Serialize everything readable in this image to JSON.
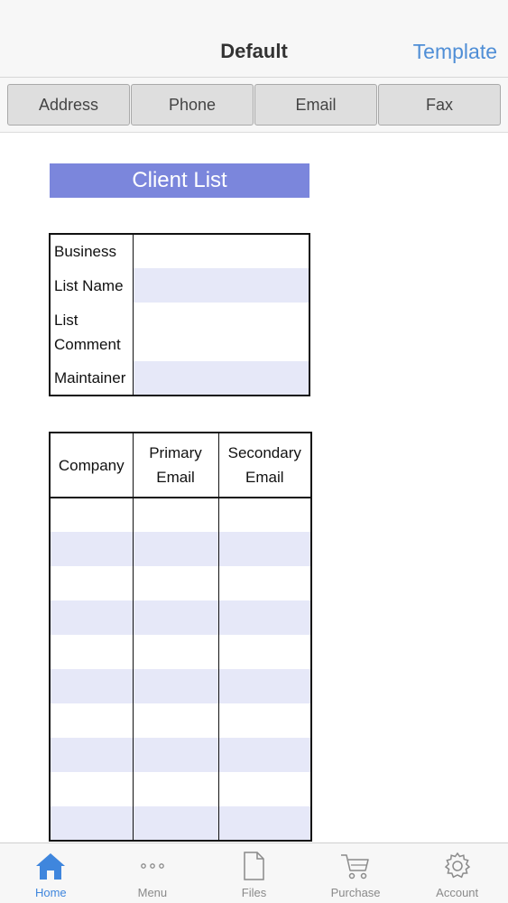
{
  "nav": {
    "title": "Default",
    "right_label": "Template"
  },
  "segments": [
    "Address",
    "Phone",
    "Email",
    "Fax"
  ],
  "document": {
    "title": "Client List",
    "info_rows": [
      {
        "label": "Business",
        "value": ""
      },
      {
        "label": "List Name",
        "value": ""
      },
      {
        "label": "List\nComment",
        "value": ""
      },
      {
        "label": "Maintainer",
        "value": ""
      }
    ],
    "columns": [
      "Company",
      "Primary\nEmail",
      "Secondary\nEmail"
    ],
    "row_count": 10
  },
  "tabbar": {
    "items": [
      {
        "label": "Home",
        "icon": "home-icon",
        "active": true
      },
      {
        "label": "Menu",
        "icon": "more-icon",
        "active": false
      },
      {
        "label": "Files",
        "icon": "file-icon",
        "active": false
      },
      {
        "label": "Purchase",
        "icon": "cart-icon",
        "active": false
      },
      {
        "label": "Account",
        "icon": "gear-icon",
        "active": false
      }
    ]
  },
  "colors": {
    "accent": "#3f86dd",
    "title_band": "#7b86dc",
    "row_shade": "#e6e8f8"
  }
}
